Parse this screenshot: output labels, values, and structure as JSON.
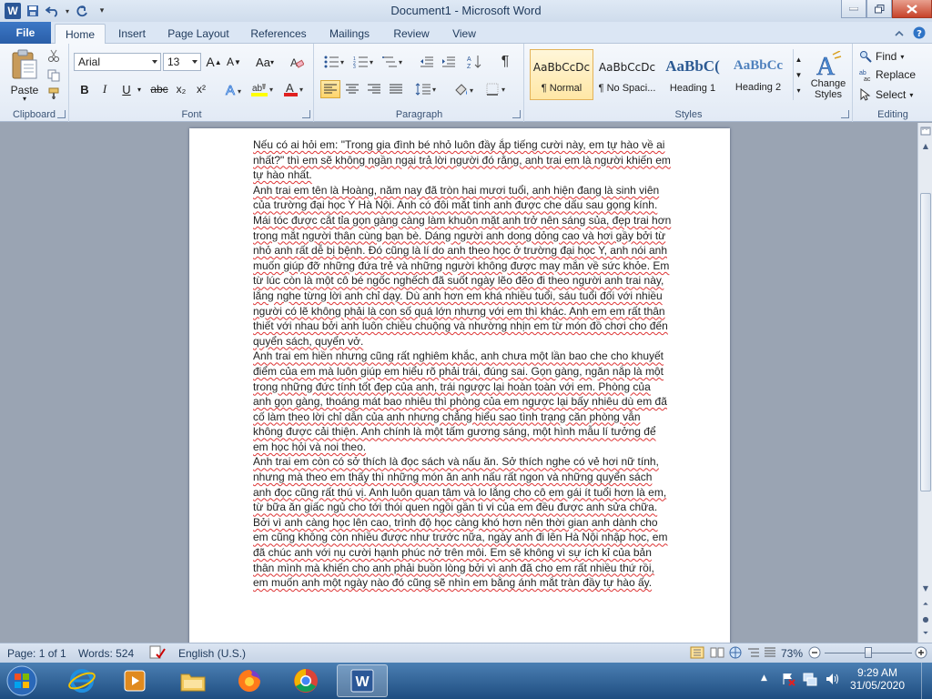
{
  "window": {
    "title": "Document1  -  Microsoft Word"
  },
  "tabs": {
    "file": "File",
    "items": [
      "Home",
      "Insert",
      "Page Layout",
      "References",
      "Mailings",
      "Review",
      "View"
    ]
  },
  "ribbon": {
    "clipboard": {
      "paste": "Paste",
      "label": "Clipboard"
    },
    "font": {
      "name": "Arial",
      "size": "13",
      "grow": "A",
      "shrink": "A",
      "case": "Aa",
      "bold": "B",
      "italic": "I",
      "underline": "U",
      "strike": "abc",
      "sub": "x₂",
      "sup": "x²",
      "label": "Font"
    },
    "paragraph": {
      "label": "Paragraph"
    },
    "styles": {
      "items": [
        {
          "sample": "AaBbCcDc",
          "name": "¶ Normal"
        },
        {
          "sample": "AaBbCcDc",
          "name": "¶ No Spaci..."
        },
        {
          "sample": "AaBbC(",
          "name": "Heading 1"
        },
        {
          "sample": "AaBbCc",
          "name": "Heading 2"
        }
      ],
      "change": "Change Styles",
      "label": "Styles"
    },
    "editing": {
      "find": "Find",
      "replace": "Replace",
      "select": "Select",
      "label": "Editing"
    }
  },
  "document": {
    "paragraphs": [
      "Nếu có ai hỏi em: \"Trong gia đình bé nhỏ luôn đầy ắp tiếng cười này, em tự hào về ai nhất?\" thì em sẽ không ngần ngại trả lời người đó rằng, anh trai em là người khiến em tự hào nhất.",
      "Anh trai em tên là Hoàng, năm nay đã tròn hai mươi tuổi, anh hiện đang là sinh viên của trường đại học Y Hà Nội. Anh có đôi mắt tinh anh được che dấu sau gọng kính. Mái tóc được cắt tỉa gọn gàng càng làm khuôn mặt anh trở nên sáng sủa, đẹp trai hơn trong mắt người thân cùng bạn bè. Dáng người anh dong dỏng cao và hơi gầy bởi từ nhỏ anh rất dễ bị bệnh. Đó cũng là lí do anh theo học ở trường đại học Y, anh nói anh muốn giúp đỡ những đứa trẻ và những người không được may mắn về sức khỏe. Em từ lúc còn là một cô bé ngốc nghếch đã suốt ngày lẽo đẽo đi theo người anh trai này, lắng nghe từng lời anh chỉ dạy. Dù anh hơn em khá nhiều tuổi, sáu tuổi đối với nhiều người có lẽ không phải là con số quá lớn nhưng với em thì khác. Anh em em rất thân thiết với nhau bởi anh luôn chiều chuộng và nhường nhịn em từ món đồ chơi cho đến quyển sách, quyển vở.",
      "Anh trai em hiền nhưng cũng rất nghiêm khắc, anh chưa một lần bao che cho khuyết điểm của em mà luôn giúp em hiểu rõ phải trái, đúng sai. Gọn gàng, ngăn nắp là một trong những đức tính tốt đẹp của anh, trái ngược lại hoàn toàn với em. Phòng của anh gọn gàng, thoáng mát bao nhiêu thì phòng của em ngược lại bấy nhiêu dù em đã cố làm theo lời chỉ dẫn của anh nhưng chẳng hiểu sao tình trạng căn phòng vẫn không được cải thiện. Anh chính là một tấm gương sáng, một hình mẫu lí tưởng để em học hỏi và noi theo.",
      "Anh trai em còn có sở thích là đọc sách và nấu ăn. Sở thích nghe có vẻ hơi nữ tính, nhưng mà theo em thấy thì những món ăn anh nấu rất ngon và những quyển sách anh đọc cũng rất thú vị. Anh luôn quan tâm và lo lắng cho cô em gái ít tuổi hơn là em, từ bữa ăn giấc ngủ cho tới thói quen ngồi gần ti vi của em đều được anh sửa chữa. Bởi vì anh càng học lên cao, trình độ học càng khó hơn nên thời gian anh dành cho em cũng không còn nhiều được như trước nữa, ngày anh đi lên Hà Nội nhập học, em đã chúc anh với nụ cười hạnh phúc nở trên môi. Em sẽ không vì sự ích kỉ của bản thân mình mà khiến cho anh phải buồn lòng bởi vì anh đã cho em rất nhiều thứ rồi, em muốn anh một ngày nào đó cũng sẽ nhìn em bằng ánh mắt tràn đầy tự hào ấy."
    ]
  },
  "status": {
    "page": "Page: 1 of 1",
    "words": "Words: 524",
    "language": "English (U.S.)",
    "zoom": "73%",
    "zoom_fraction": 0.5
  },
  "taskbar": {
    "time": "9:29 AM",
    "date": "31/05/2020"
  },
  "colors": {
    "accent": "#2b5797",
    "file_tab": "#2a5ea8"
  }
}
